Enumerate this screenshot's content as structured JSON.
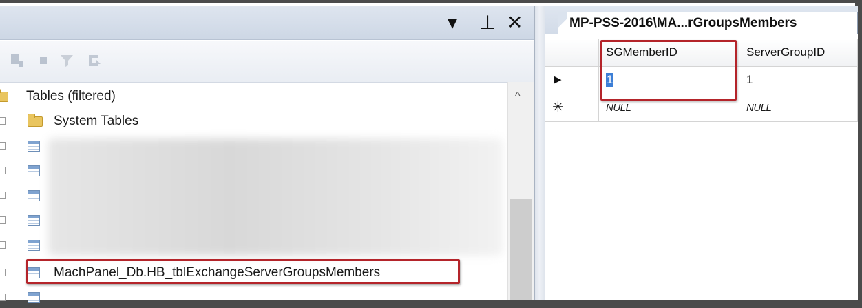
{
  "explorer": {
    "controls": {
      "dropdown": "▾",
      "pin": "⊥",
      "close": "✕"
    },
    "tree": {
      "root_label": "Tables (filtered)",
      "system_tables_label": "System Tables",
      "selected_table_label": "MachPanel_Db.HB_tblExchangeServerGroupsMembers"
    }
  },
  "document": {
    "tab_title": "MP-PSS-2016\\MA...rGroupsMembers",
    "columns": [
      "SGMemberID",
      "ServerGroupID"
    ],
    "rows": [
      {
        "indicator": "▶",
        "SGMemberID": "1",
        "ServerGroupID": "1"
      },
      {
        "indicator": "✳",
        "SGMemberID": "NULL",
        "ServerGroupID": "NULL"
      }
    ]
  }
}
